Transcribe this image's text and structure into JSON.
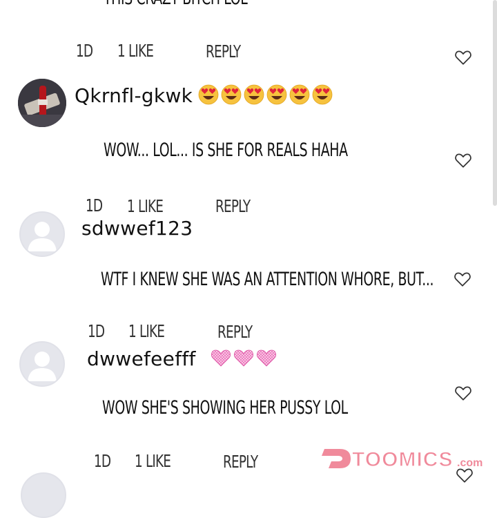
{
  "top_partial_comment": "THIS CRAZY BITCH LOL",
  "comments": [
    {
      "username": "Qkrnfl-gkwk",
      "emoji_count": 6,
      "text": "WOW... LOL... IS SHE FOR REALS HAHA",
      "time": "1D",
      "likes": "1 LIKE",
      "reply": "REPLY"
    },
    {
      "username": "sdwwef123",
      "text": "WTF I KNEW SHE WAS AN ATTENTION WHORE, BUT...",
      "time": "1D",
      "likes": "1 LIKE",
      "reply": "REPLY"
    },
    {
      "username": "dwwefeefff",
      "emoji_count": 3,
      "text": "WOW SHE'S SHOWING HER PUSSY LOL",
      "time": "1D",
      "likes": "1 LIKE",
      "reply": "REPLY"
    }
  ],
  "top_meta": {
    "time": "1D",
    "likes": "1 LIKE",
    "reply": "REPLY"
  },
  "watermark": "TOOMICS.com",
  "icons": {
    "like": "heart-outline-icon",
    "avatar_default": "default-user-icon",
    "emoji_heart_eyes": "heart-eyes-emoji",
    "emoji_pink_heart": "pink-heart-emoji"
  },
  "colors": {
    "emoji_face": "#f6c23e",
    "emoji_heart": "#e0243b",
    "pink_heart": "#ee7ec0",
    "watermark": "#f08a9b"
  }
}
